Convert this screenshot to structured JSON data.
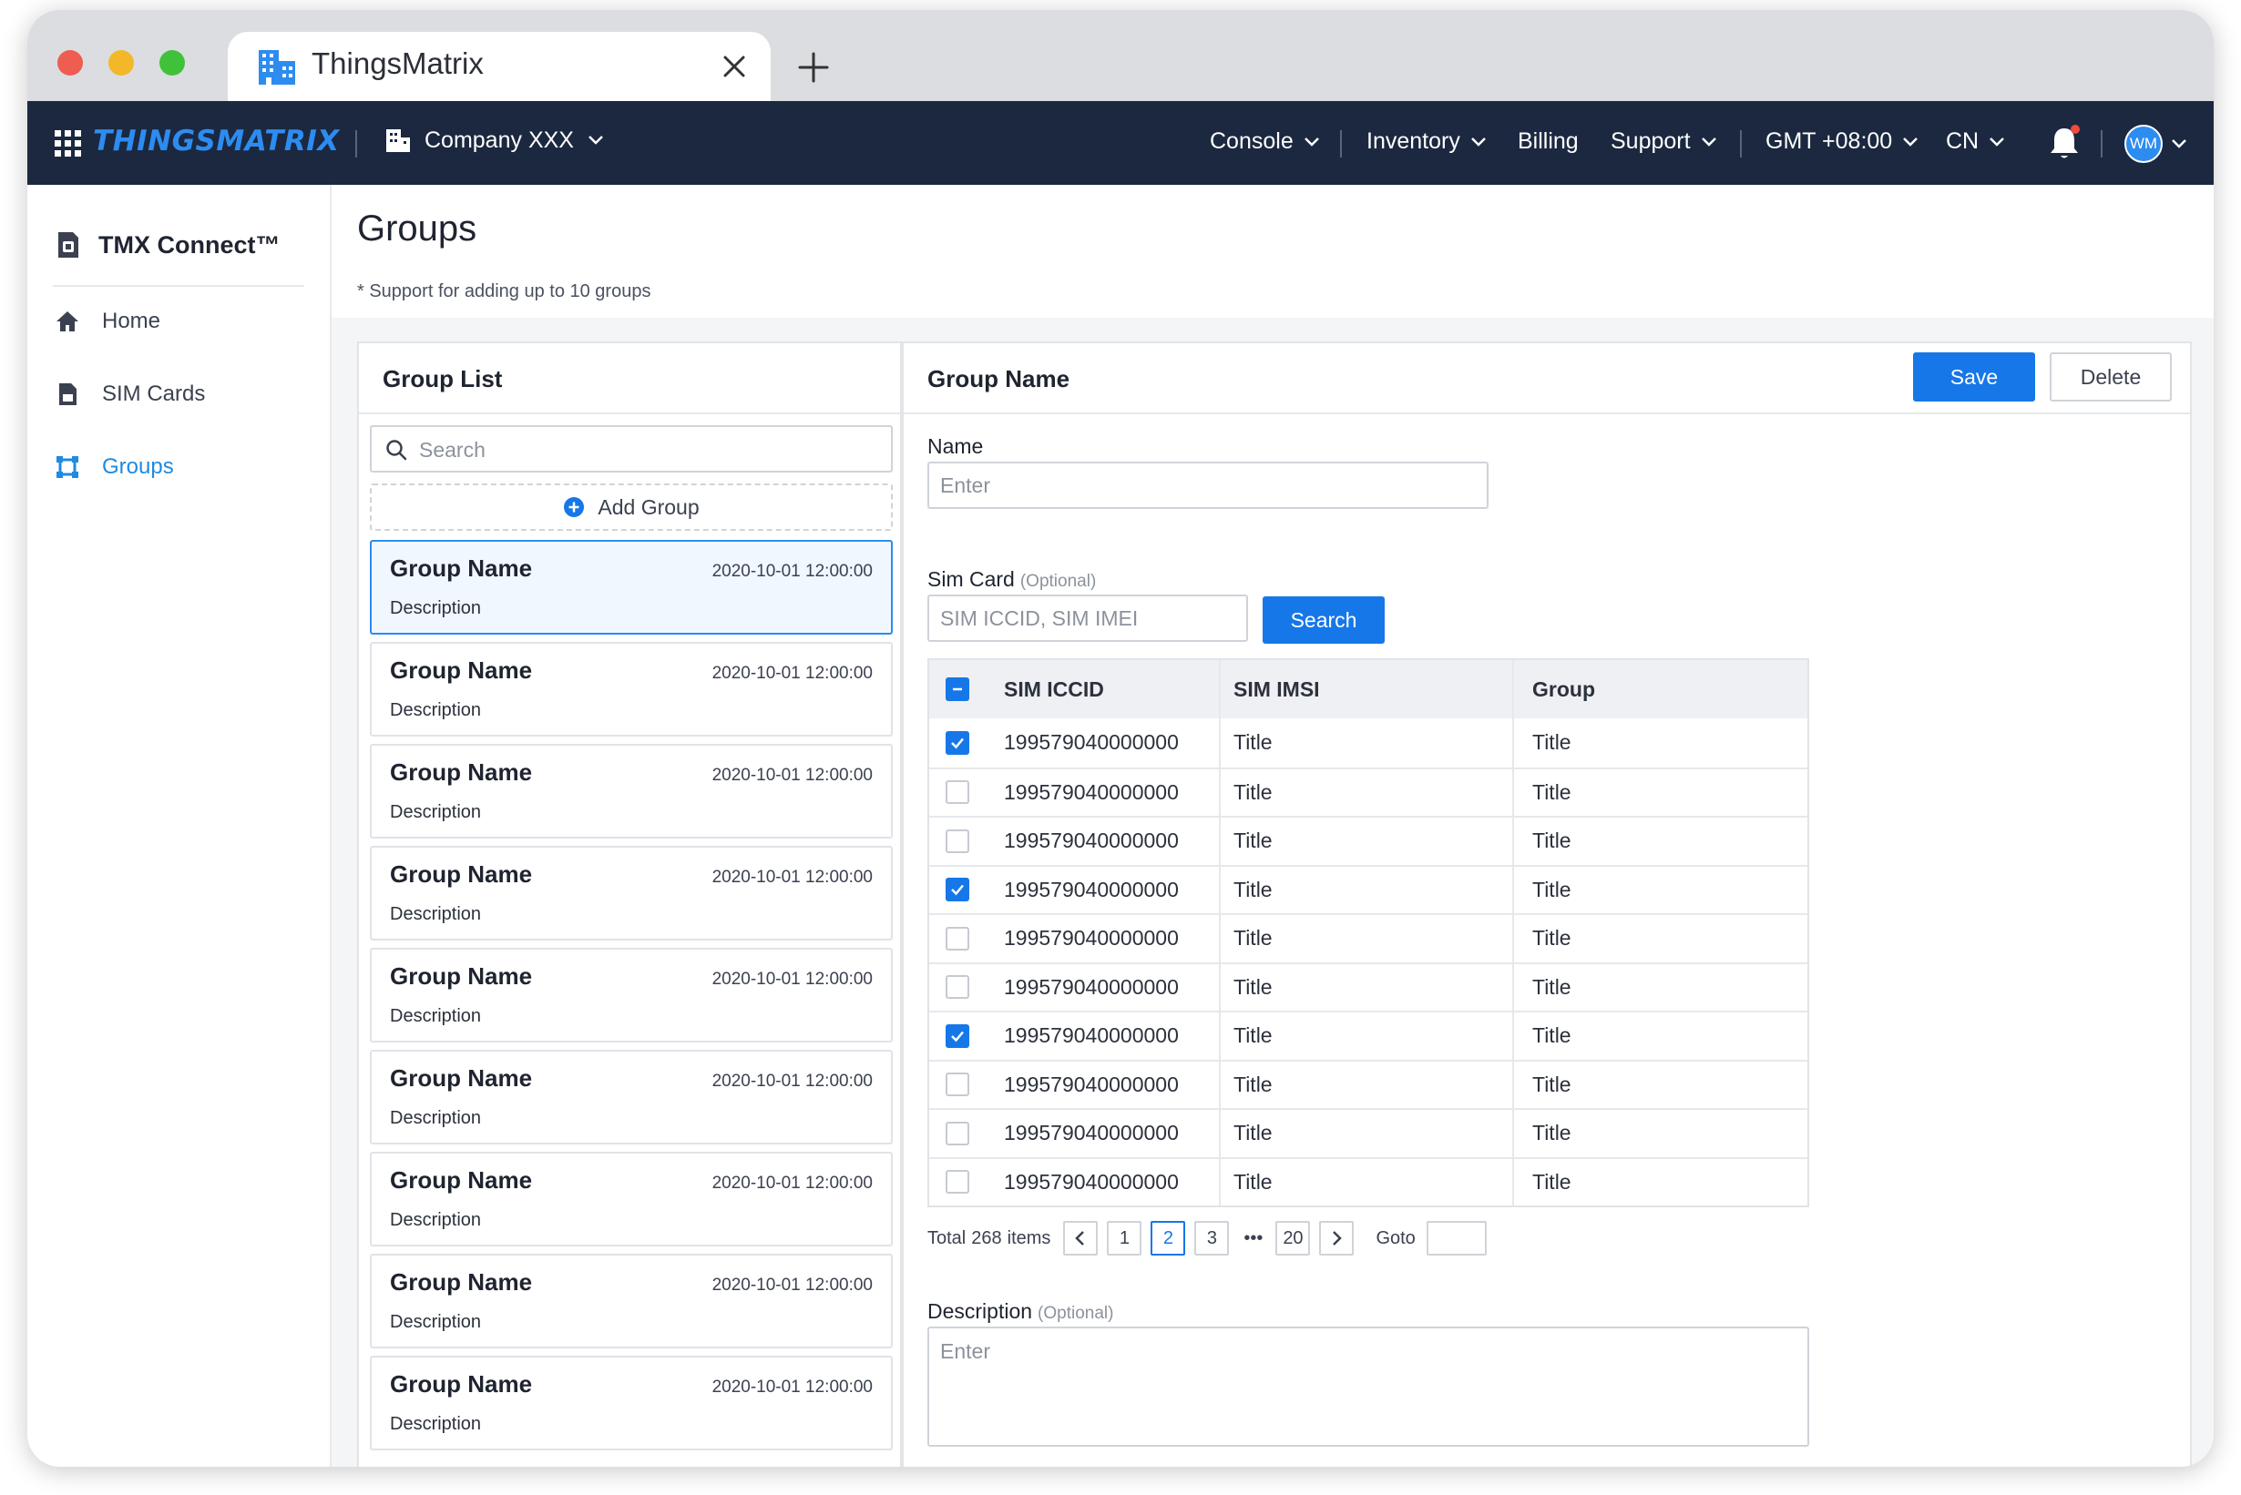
{
  "browser": {
    "tab_title": "ThingsMatrix",
    "tab_icon": "building-icon"
  },
  "navbar": {
    "brand": "THINGSMATRIX",
    "company": "Company XXX",
    "menu": [
      {
        "label": "Console",
        "has_dropdown": true
      },
      {
        "label": "Inventory",
        "has_dropdown": true
      },
      {
        "label": "Billing",
        "has_dropdown": false
      },
      {
        "label": "Support",
        "has_dropdown": true
      },
      {
        "label": "GMT +08:00",
        "has_dropdown": true
      },
      {
        "label": "CN",
        "has_dropdown": true
      }
    ],
    "avatar_initials": "WM",
    "accent_color": "#2d8cf0",
    "background_color": "#1b2840"
  },
  "sidebar": {
    "product": "TMX Connect™",
    "items": [
      {
        "label": "Home",
        "icon": "home-icon",
        "active": false
      },
      {
        "label": "SIM Cards",
        "icon": "sim-card-icon",
        "active": false
      },
      {
        "label": "Groups",
        "icon": "groups-icon",
        "active": true
      }
    ]
  },
  "page": {
    "title": "Groups",
    "note": "* Support for adding up to 10 groups"
  },
  "group_list": {
    "title": "Group List",
    "search_placeholder": "Search",
    "add_label": "Add Group",
    "items": [
      {
        "name": "Group Name",
        "date": "2020-10-01 12:00:00",
        "description": "Description",
        "selected": true
      },
      {
        "name": "Group Name",
        "date": "2020-10-01 12:00:00",
        "description": "Description",
        "selected": false
      },
      {
        "name": "Group Name",
        "date": "2020-10-01 12:00:00",
        "description": "Description",
        "selected": false
      },
      {
        "name": "Group Name",
        "date": "2020-10-01 12:00:00",
        "description": "Description",
        "selected": false
      },
      {
        "name": "Group Name",
        "date": "2020-10-01 12:00:00",
        "description": "Description",
        "selected": false
      },
      {
        "name": "Group Name",
        "date": "2020-10-01 12:00:00",
        "description": "Description",
        "selected": false
      },
      {
        "name": "Group Name",
        "date": "2020-10-01 12:00:00",
        "description": "Description",
        "selected": false
      },
      {
        "name": "Group Name",
        "date": "2020-10-01 12:00:00",
        "description": "Description",
        "selected": false
      },
      {
        "name": "Group Name",
        "date": "2020-10-01 12:00:00",
        "description": "Description",
        "selected": false
      }
    ]
  },
  "detail": {
    "title": "Group Name",
    "save_label": "Save",
    "delete_label": "Delete",
    "name_label": "Name",
    "name_placeholder": "Enter",
    "sim_label": "Sim Card",
    "optional_label": "(Optional)",
    "sim_placeholder": "SIM ICCID, SIM IMEI",
    "search_label": "Search",
    "table": {
      "headers": [
        "SIM ICCID",
        "SIM IMSI",
        "Group"
      ],
      "header_checkbox": "indeterminate",
      "rows": [
        {
          "iccid": "199579040000000",
          "imsi": "Title",
          "group": "Title",
          "checked": true
        },
        {
          "iccid": "199579040000000",
          "imsi": "Title",
          "group": "Title",
          "checked": false
        },
        {
          "iccid": "199579040000000",
          "imsi": "Title",
          "group": "Title",
          "checked": false
        },
        {
          "iccid": "199579040000000",
          "imsi": "Title",
          "group": "Title",
          "checked": true
        },
        {
          "iccid": "199579040000000",
          "imsi": "Title",
          "group": "Title",
          "checked": false
        },
        {
          "iccid": "199579040000000",
          "imsi": "Title",
          "group": "Title",
          "checked": false
        },
        {
          "iccid": "199579040000000",
          "imsi": "Title",
          "group": "Title",
          "checked": true
        },
        {
          "iccid": "199579040000000",
          "imsi": "Title",
          "group": "Title",
          "checked": false
        },
        {
          "iccid": "199579040000000",
          "imsi": "Title",
          "group": "Title",
          "checked": false
        },
        {
          "iccid": "199579040000000",
          "imsi": "Title",
          "group": "Title",
          "checked": false
        }
      ]
    },
    "pagination": {
      "total_prefix": "Total",
      "total": "268",
      "total_suffix": "items",
      "pages": [
        "1",
        "2",
        "3"
      ],
      "current": "2",
      "ellipsis": "•••",
      "last": "20",
      "goto_label": "Goto"
    },
    "description_label": "Description",
    "description_placeholder": "Enter"
  }
}
